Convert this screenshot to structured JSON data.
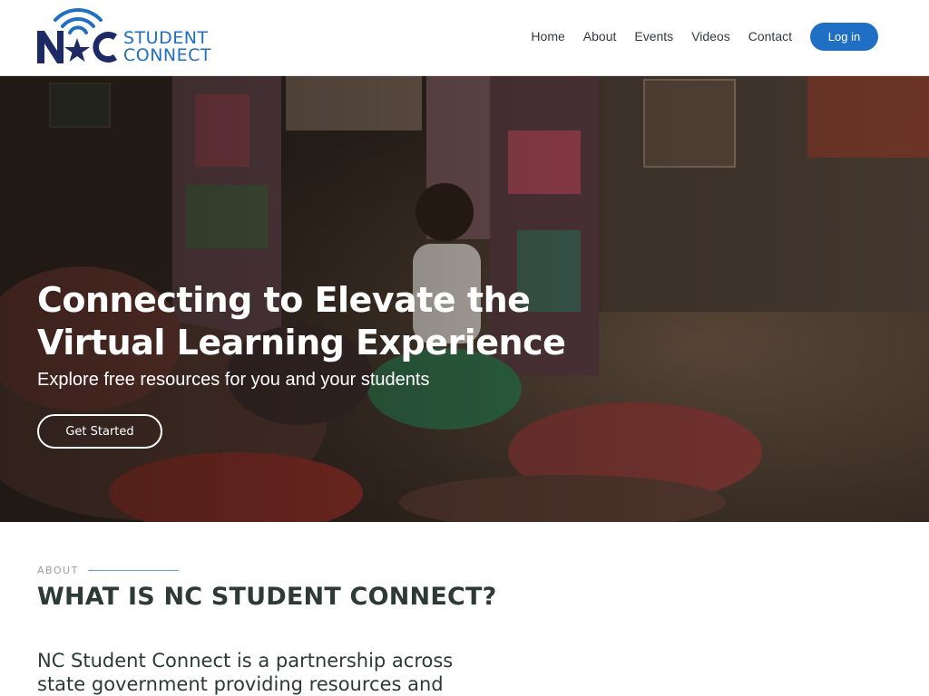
{
  "brand": {
    "logo_letters": "NC",
    "logo_line1": "STUDENT",
    "logo_line2": "CONNECT",
    "primary_color": "#1f6fc4",
    "navy_color": "#1d2a66"
  },
  "nav": {
    "items": [
      {
        "label": "Home"
      },
      {
        "label": "About"
      },
      {
        "label": "Events"
      },
      {
        "label": "Videos"
      },
      {
        "label": "Contact"
      }
    ],
    "login_label": "Log in"
  },
  "hero": {
    "title_line1": "Connecting to Elevate the",
    "title_line2": "Virtual Learning Experience",
    "subtitle": "Explore free resources for you and your students",
    "cta_label": "Get Started"
  },
  "about": {
    "eyebrow": "ABOUT",
    "title": "WHAT IS NC STUDENT CONNECT?",
    "body_line1": "NC Student Connect is a partnership across",
    "body_line2": "state government providing resources and"
  }
}
